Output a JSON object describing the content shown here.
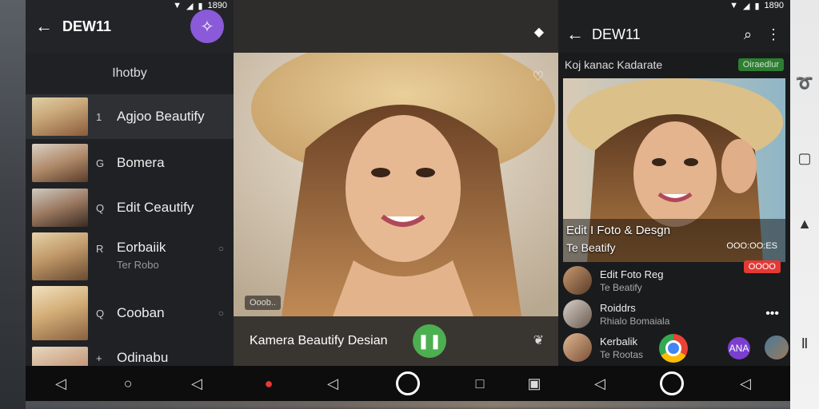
{
  "status": {
    "left_time": "1890",
    "right_time": "1890"
  },
  "left_panel": {
    "title": "DEW11",
    "list_header": "Ihotby",
    "items": [
      {
        "bullet": "1",
        "label": "Agjoo Beautify",
        "sub": "",
        "active": true
      },
      {
        "bullet": "G",
        "label": "Bomera",
        "sub": ""
      },
      {
        "bullet": "Q",
        "label": "Edit Ceautify",
        "sub": ""
      },
      {
        "bullet": "R",
        "label": "Eorbaiik",
        "sub": "Ter Robo"
      },
      {
        "bullet": "Q",
        "label": "Cooban",
        "sub": ""
      },
      {
        "bullet": "+",
        "label": "Odinabu",
        "sub": ""
      }
    ]
  },
  "center_panel": {
    "small_chip": "Ooob..",
    "bottom_label": "Kamera Beautify Desian"
  },
  "right_panel": {
    "title": "DEW11",
    "line1": "Koj kanac  Kadarate",
    "badge": "Oiraedlur",
    "caption1": "Edit I Foto & Desgn",
    "caption2": "Te Beatify",
    "counter": "OOO:OO:ES",
    "red_chip": "OOOO",
    "chats": [
      {
        "t1": "Edit Foto Reg",
        "t2": "Te Beatify"
      },
      {
        "t1": "Roiddrs",
        "t2": "Rhialo Bomaiala"
      },
      {
        "t1": "Kerbalik",
        "t2": "Te Rootas"
      }
    ],
    "chat_badge": "ANA"
  },
  "colors": {
    "accent_purple": "#8a5ad8",
    "green": "#4caf50",
    "badge_green": "#2e7d32",
    "red": "#e53935"
  }
}
